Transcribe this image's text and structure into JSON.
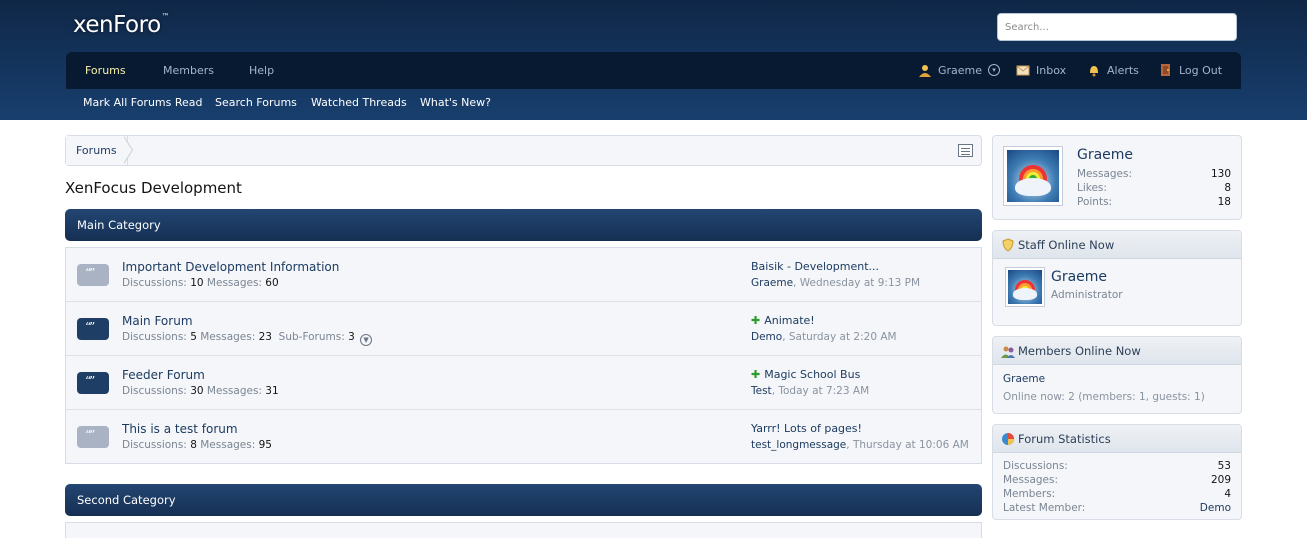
{
  "header": {
    "logo_text": "xenForo",
    "logo_tm": "™",
    "search_placeholder": "Search..."
  },
  "nav": {
    "tabs": [
      {
        "label": "Forums",
        "active": true
      },
      {
        "label": "Members",
        "active": false
      },
      {
        "label": "Help",
        "active": false
      }
    ],
    "user": {
      "label": "Graeme",
      "dropdown": "▾"
    },
    "inbox": "Inbox",
    "alerts": "Alerts",
    "logout": "Log Out"
  },
  "subnav": [
    "Mark All Forums Read",
    "Search Forums",
    "Watched Threads",
    "What's New?"
  ],
  "breadcrumb": {
    "items": [
      "Forums"
    ]
  },
  "page_title": "XenFocus Development",
  "categories": [
    {
      "title": "Main Category",
      "nodes": [
        {
          "title": "Important Development Information",
          "unread": false,
          "discussions_label": "Discussions:",
          "discussions": "10",
          "messages_label": "Messages:",
          "messages": "60",
          "last_title": "Baisik - Development...",
          "last_user": "Graeme",
          "last_time": "Wednesday at 9:13 PM",
          "last_new": false
        },
        {
          "title": "Main Forum",
          "unread": true,
          "discussions_label": "Discussions:",
          "discussions": "5",
          "messages_label": "Messages:",
          "messages": "23",
          "subforums_label": "Sub-Forums:",
          "subforums": "3",
          "last_title": "Animate!",
          "last_user": "Demo",
          "last_time": "Saturday at 2:20 AM",
          "last_new": true
        },
        {
          "title": "Feeder Forum",
          "unread": true,
          "discussions_label": "Discussions:",
          "discussions": "30",
          "messages_label": "Messages:",
          "messages": "31",
          "last_title": "Magic School Bus",
          "last_user": "Test",
          "last_time": "Today at 7:23 AM",
          "last_new": true
        },
        {
          "title": "This is a test forum",
          "unread": false,
          "discussions_label": "Discussions:",
          "discussions": "8",
          "messages_label": "Messages:",
          "messages": "95",
          "last_title": "Yarrr! Lots of pages!",
          "last_user": "test_longmessage",
          "last_time": "Thursday at 10:06 AM",
          "last_new": false
        }
      ]
    },
    {
      "title": "Second Category",
      "nodes": []
    }
  ],
  "sidebar": {
    "visitor": {
      "name": "Graeme",
      "stats": [
        {
          "label": "Messages:",
          "value": "130"
        },
        {
          "label": "Likes:",
          "value": "8"
        },
        {
          "label": "Points:",
          "value": "18"
        }
      ]
    },
    "staff_online": {
      "title": "Staff Online Now",
      "name": "Graeme",
      "role": "Administrator"
    },
    "members_online": {
      "title": "Members Online Now",
      "user": "Graeme",
      "summary": "Online now: 2 (members: 1, guests: 1)"
    },
    "forum_stats": {
      "title": "Forum Statistics",
      "rows": [
        {
          "label": "Discussions:",
          "value": "53"
        },
        {
          "label": "Messages:",
          "value": "209"
        },
        {
          "label": "Members:",
          "value": "4"
        },
        {
          "label": "Latest Member:",
          "value": "Demo"
        }
      ]
    }
  },
  "colors": {
    "header_top": "#0f2747",
    "header_bottom": "#183f6e",
    "nav_bar": "#081a31",
    "active_tab": "#f5f0aa",
    "link": "#1d3b61",
    "new_post_plus": "#2c9a2c"
  }
}
